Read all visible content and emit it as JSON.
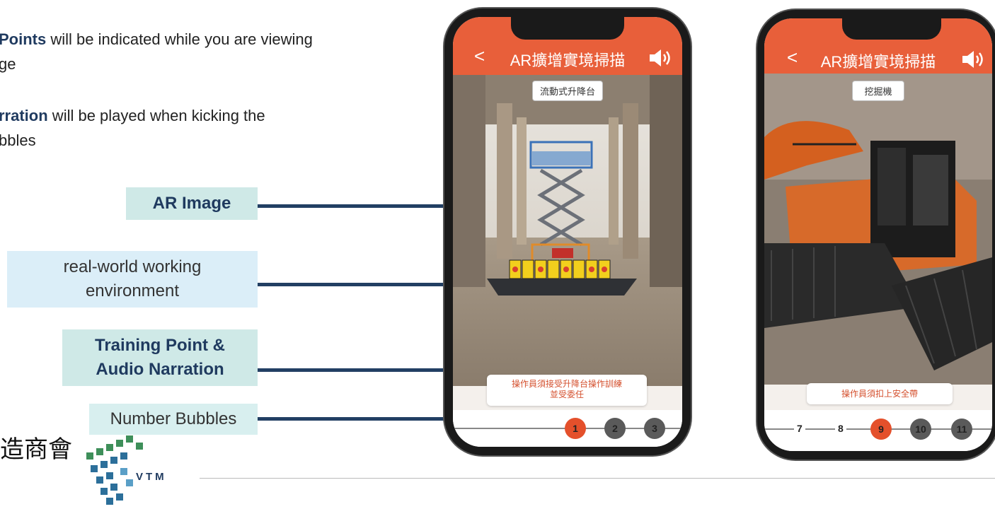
{
  "bullets": [
    {
      "bold": "Points",
      "rest": " will be indicated while you are viewing"
    },
    {
      "bold": "",
      "rest": "ge"
    },
    {
      "bold": "rration",
      "rest": " will be played when kicking  the"
    },
    {
      "bold": "",
      "rest": "bbles"
    }
  ],
  "labels": {
    "ar_image": "AR Image",
    "environment_1": "real-world working",
    "environment_2": "environment",
    "training_1": "Training Point &",
    "training_2": "Audio Narration",
    "number_bubbles": "Number Bubbles"
  },
  "phone1": {
    "title": "AR擴增實境掃描",
    "back": "<",
    "tag": "流動式升降台",
    "caption_1": "操作員須接受升降台操作訓練",
    "caption_2": "並受委任",
    "bubbles": [
      "1",
      "2",
      "3"
    ],
    "active": "1"
  },
  "phone2": {
    "title": "AR擴增實境掃描",
    "back": "<",
    "tag": "挖掘機",
    "caption": "操作員須扣上安全帶",
    "numbers": [
      "7",
      "8"
    ],
    "bubbles": [
      "9",
      "10",
      "11"
    ],
    "active": "9"
  },
  "footer": {
    "chinese_fragment": "造商會",
    "logo_text": "VTM"
  },
  "colors": {
    "accent": "#e85f3a",
    "navy": "#223f63",
    "teal_box": "#cfe9e7",
    "blue_box": "#dbeef8"
  }
}
